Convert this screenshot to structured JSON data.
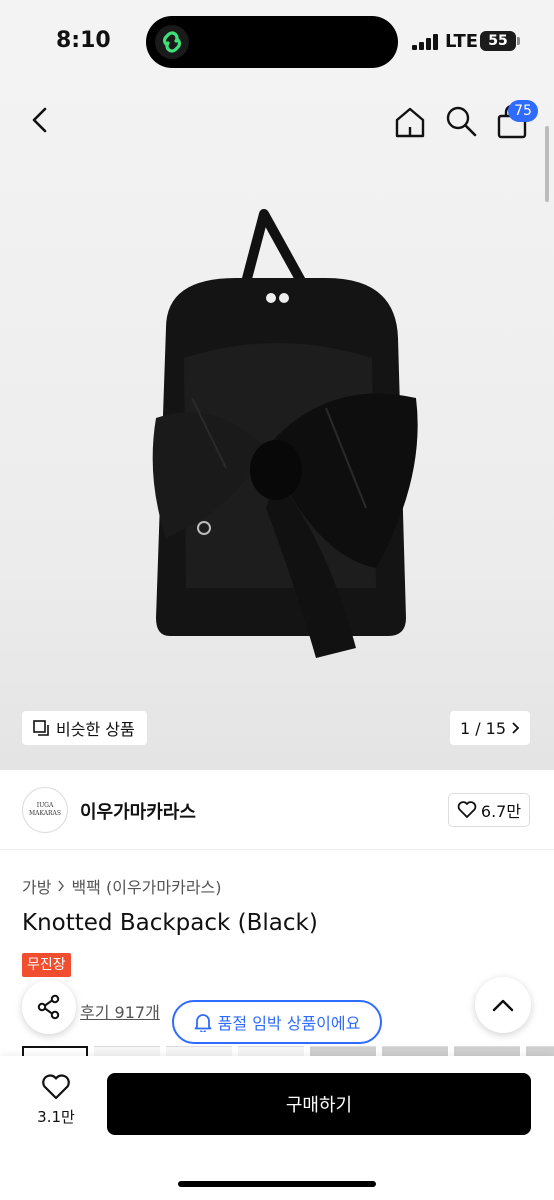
{
  "status_bar": {
    "time": "8:10",
    "network": "LTE",
    "battery": "55"
  },
  "header": {
    "cart_count": "75"
  },
  "gallery": {
    "similar_label": "비슷한 상품",
    "pager": "1 / 15"
  },
  "brand": {
    "logo_line1": "IUGA",
    "logo_line2": "MAKARAS",
    "name": "이우가마카라스",
    "likes": "6.7만"
  },
  "breadcrumb": {
    "category": "가방",
    "subcategory": "백팩 (이우가마카라스)"
  },
  "product": {
    "title": "Knotted Backpack (Black)",
    "tag": "무진장",
    "reviews": "후기 917개"
  },
  "alert": {
    "label": "품절 임박 상품이에요"
  },
  "bottom_bar": {
    "wish_count": "3.1만",
    "buy_label": "구매하기"
  },
  "colors": {
    "accent": "#2f6bff",
    "tag": "#f04e2e",
    "buy_button": "#000000"
  }
}
